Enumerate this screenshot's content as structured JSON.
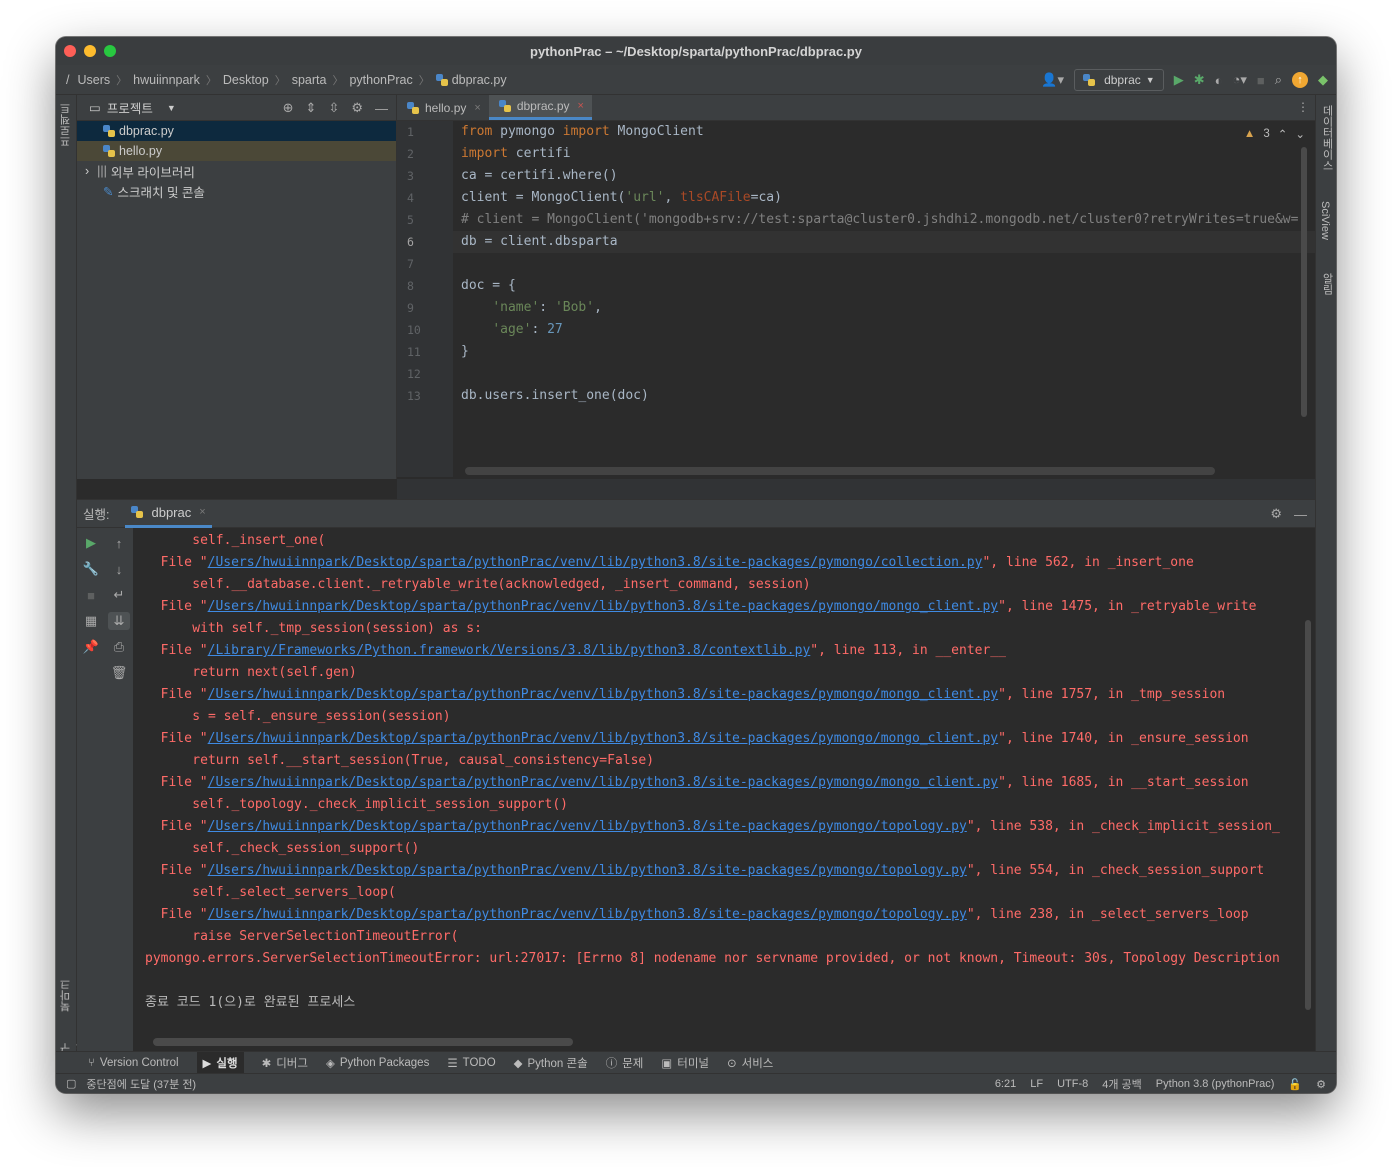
{
  "window": {
    "title": "pythonPrac – ~/Desktop/sparta/pythonPrac/dbprac.py"
  },
  "navbar": {
    "root": "/",
    "breadcrumbs": [
      "Users",
      "hwuiinnpark",
      "Desktop",
      "sparta",
      "pythonPrac",
      "dbprac.py"
    ],
    "run_config": "dbprac"
  },
  "left_strip": {
    "project_tab": "프로젝트",
    "bookmarks_tab": "북마크",
    "structure_tab": "구조"
  },
  "right_strip": {
    "database_tab": "데이터베이스",
    "sciview_tab": "SciView",
    "notifications_tab": "알림"
  },
  "project_panel": {
    "title": "프로젝트",
    "items": [
      {
        "label": "dbprac.py",
        "icon": "python-file-icon"
      },
      {
        "label": "hello.py",
        "icon": "python-file-icon"
      },
      {
        "label": "외부 라이브러리",
        "icon": "library-icon"
      },
      {
        "label": "스크래치 및 콘솔",
        "icon": "scratch-icon"
      }
    ]
  },
  "editor": {
    "tabs": [
      {
        "label": "hello.py",
        "active": false
      },
      {
        "label": "dbprac.py",
        "active": true
      }
    ],
    "warning_count": "3",
    "line_numbers": [
      "1",
      "2",
      "3",
      "4",
      "5",
      "6",
      "7",
      "8",
      "9",
      "10",
      "11",
      "12",
      "13"
    ],
    "current_line": "6",
    "code": {
      "l1": {
        "kw1": "from",
        "t1": " pymongo ",
        "kw2": "import",
        "t2": " MongoClient"
      },
      "l2": {
        "kw1": "import",
        "t1": " certifi"
      },
      "l3": {
        "t1": "ca = certifi.where()"
      },
      "l4": {
        "t1": "client = MongoClient(",
        "s1": "'url'",
        "t2": ", ",
        "p1": "tlsCAFile",
        "t3": "=ca)"
      },
      "l5": {
        "c1": "# client = MongoClient('mongodb+srv://test:sparta@cluster0.jshdhi2.mongodb.net/cluster0?retryWrites=true&w="
      },
      "l6": {
        "t1": "db = client.dbsparta"
      },
      "l7": {
        "t1": ""
      },
      "l8": {
        "t1": "doc = {"
      },
      "l9": {
        "t0": "    ",
        "s1": "'name'",
        "t1": ": ",
        "s2": "'Bob'",
        "t2": ","
      },
      "l10": {
        "t0": "    ",
        "s1": "'age'",
        "t1": ": ",
        "n1": "27"
      },
      "l11": {
        "t1": "}"
      },
      "l12": {
        "t1": ""
      },
      "l13": {
        "t1": "db.users.insert_one(doc)"
      }
    }
  },
  "run_panel": {
    "label": "실행:",
    "tab": "dbprac",
    "console": [
      {
        "type": "code",
        "text": "    self._insert_one("
      },
      {
        "type": "file",
        "pre": "  File \"",
        "link": "/Users/hwuiinnpark/Desktop/sparta/pythonPrac/venv/lib/python3.8/site-packages/pymongo/collection.py",
        "post": "\", line 562, in _insert_one"
      },
      {
        "type": "code",
        "text": "    self.__database.client._retryable_write(acknowledged, _insert_command, session)"
      },
      {
        "type": "file",
        "pre": "  File \"",
        "link": "/Users/hwuiinnpark/Desktop/sparta/pythonPrac/venv/lib/python3.8/site-packages/pymongo/mongo_client.py",
        "post": "\", line 1475, in _retryable_write"
      },
      {
        "type": "code",
        "text": "    with self._tmp_session(session) as s:"
      },
      {
        "type": "file",
        "pre": "  File \"",
        "link": "/Library/Frameworks/Python.framework/Versions/3.8/lib/python3.8/contextlib.py",
        "post": "\", line 113, in __enter__"
      },
      {
        "type": "code",
        "text": "    return next(self.gen)"
      },
      {
        "type": "file",
        "pre": "  File \"",
        "link": "/Users/hwuiinnpark/Desktop/sparta/pythonPrac/venv/lib/python3.8/site-packages/pymongo/mongo_client.py",
        "post": "\", line 1757, in _tmp_session"
      },
      {
        "type": "code",
        "text": "    s = self._ensure_session(session)"
      },
      {
        "type": "file",
        "pre": "  File \"",
        "link": "/Users/hwuiinnpark/Desktop/sparta/pythonPrac/venv/lib/python3.8/site-packages/pymongo/mongo_client.py",
        "post": "\", line 1740, in _ensure_session"
      },
      {
        "type": "code",
        "text": "    return self.__start_session(True, causal_consistency=False)"
      },
      {
        "type": "file",
        "pre": "  File \"",
        "link": "/Users/hwuiinnpark/Desktop/sparta/pythonPrac/venv/lib/python3.8/site-packages/pymongo/mongo_client.py",
        "post": "\", line 1685, in __start_session"
      },
      {
        "type": "code",
        "text": "    self._topology._check_implicit_session_support()"
      },
      {
        "type": "file",
        "pre": "  File \"",
        "link": "/Users/hwuiinnpark/Desktop/sparta/pythonPrac/venv/lib/python3.8/site-packages/pymongo/topology.py",
        "post": "\", line 538, in _check_implicit_session_"
      },
      {
        "type": "code",
        "text": "    self._check_session_support()"
      },
      {
        "type": "file",
        "pre": "  File \"",
        "link": "/Users/hwuiinnpark/Desktop/sparta/pythonPrac/venv/lib/python3.8/site-packages/pymongo/topology.py",
        "post": "\", line 554, in _check_session_support"
      },
      {
        "type": "code",
        "text": "    self._select_servers_loop("
      },
      {
        "type": "file",
        "pre": "  File \"",
        "link": "/Users/hwuiinnpark/Desktop/sparta/pythonPrac/venv/lib/python3.8/site-packages/pymongo/topology.py",
        "post": "\", line 238, in _select_servers_loop"
      },
      {
        "type": "code",
        "text": "    raise ServerSelectionTimeoutError("
      },
      {
        "type": "error",
        "text": "pymongo.errors.ServerSelectionTimeoutError: url:27017: [Errno 8] nodename nor servname provided, or not known, Timeout: 30s, Topology Description"
      },
      {
        "type": "blank",
        "text": ""
      },
      {
        "type": "exit",
        "text": "종료 코드 1(으)로 완료된 프로세스"
      }
    ]
  },
  "tool_windows": [
    "Version Control",
    "실행",
    "디버그",
    "Python Packages",
    "TODO",
    "Python 콘솔",
    "문제",
    "터미널",
    "서비스"
  ],
  "statusbar": {
    "message": "중단점에 도달 (37분 전)",
    "position": "6:21",
    "line_sep": "LF",
    "encoding": "UTF-8",
    "indent": "4개 공백",
    "interpreter": "Python 3.8 (pythonPrac)"
  }
}
